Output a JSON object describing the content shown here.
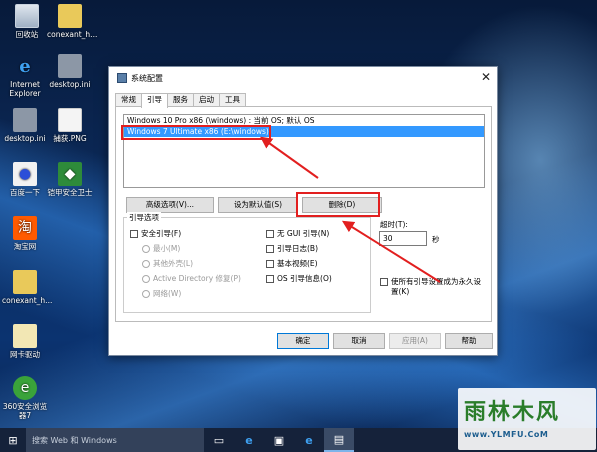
{
  "desktop": {
    "icons": [
      {
        "label": "回收站",
        "icon": "recycle-bin-icon"
      },
      {
        "label": "conexant_h...",
        "icon": "folder-icon"
      },
      {
        "label": "Internet Explorer",
        "icon": "ie-icon"
      },
      {
        "label": "desktop.ini",
        "icon": "ini-file-icon"
      },
      {
        "label": "desktop.ini",
        "icon": "ini-file-icon"
      },
      {
        "label": "捕获.PNG",
        "icon": "png-file-icon"
      },
      {
        "label": "百度一下",
        "icon": "baidu-icon"
      },
      {
        "label": "铠甲安全卫士",
        "icon": "shield-app-icon"
      },
      {
        "label": "淘宝网",
        "icon": "taobao-icon"
      },
      {
        "label": "conexant_h...",
        "icon": "folder-icon"
      },
      {
        "label": "网卡驱动",
        "icon": "file-icon"
      },
      {
        "label": "360安全浏览器7",
        "icon": "360-browser-icon"
      }
    ]
  },
  "dialog": {
    "title": "系统配置",
    "close_glyph": "✕",
    "tabs": [
      "常规",
      "引导",
      "服务",
      "启动",
      "工具"
    ],
    "active_tab": "引导",
    "os_entries": [
      "Windows 10 Pro x86 (\\windows) : 当前 OS; 默认 OS",
      "Windows 7 Ultimate x86 (E:\\windows)"
    ],
    "buttons": {
      "advanced": "高级选项(V)...",
      "set_default": "设为默认值(S)",
      "delete": "删除(D)"
    },
    "boot_options": {
      "label": "引导选项",
      "safe_boot": "安全引导(F)",
      "minimal": "最小(M)",
      "alternate_shell": "其他外壳(L)",
      "active_directory": "Active Directory 修复(P)",
      "network": "网络(W)",
      "no_gui": "无 GUI 引导(N)",
      "boot_log": "引导日志(B)",
      "base_video": "基本视频(E)",
      "os_boot_info": "OS 引导信息(O)"
    },
    "timeout": {
      "label": "超时(T):",
      "value": "30",
      "unit": "秒"
    },
    "make_permanent": "使所有引导设置成为永久设置(K)",
    "footer": {
      "ok": "确定",
      "cancel": "取消",
      "apply": "应用(A)",
      "help": "帮助"
    }
  },
  "taskbar": {
    "start_glyph": "⊞",
    "search_placeholder": "搜索 Web 和 Windows"
  },
  "watermark": {
    "title": "雨林木风",
    "url": "www.YLMFU.CoM"
  },
  "colors": {
    "selection": "#3399ff",
    "annotation": "#e21f1f",
    "taskbar": "#15223a"
  }
}
